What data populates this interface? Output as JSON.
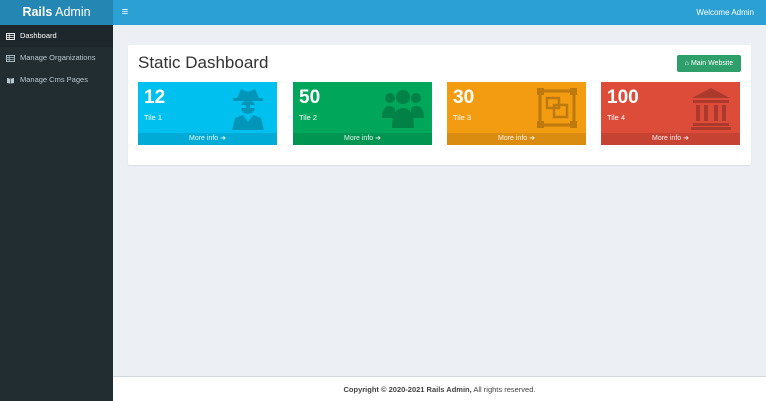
{
  "header": {
    "logo_bold": "Rails",
    "logo_light": "Admin",
    "menu_toggle": "≡",
    "welcome": "Welcome Admin"
  },
  "sidebar": {
    "items": [
      {
        "label": "Dashboard",
        "icon": "table-icon",
        "active": true
      },
      {
        "label": "Manage Organizations",
        "icon": "table-icon",
        "active": false
      },
      {
        "label": "Manage Cms Pages",
        "icon": "book-icon",
        "active": false
      }
    ]
  },
  "main": {
    "title": "Static Dashboard",
    "main_website_button": "Main Website",
    "tiles": [
      {
        "value": "12",
        "label": "Tile 1",
        "more": "More info",
        "icon": "user-secret-icon",
        "color": "#00c0ef"
      },
      {
        "value": "50",
        "label": "Tile 2",
        "more": "More info",
        "icon": "users-icon",
        "color": "#00a65a"
      },
      {
        "value": "30",
        "label": "Tile 3",
        "more": "More info",
        "icon": "object-group-icon",
        "color": "#f39c12"
      },
      {
        "value": "100",
        "label": "Tile 4",
        "more": "More info",
        "icon": "institution-icon",
        "color": "#dd4b39"
      }
    ]
  },
  "footer": {
    "copyright_bold": "Copyright © 2020-2021 Rails Admin,",
    "copyright_rest": " All rights reserved."
  },
  "colors": {
    "topbar": "#2aa0d4",
    "logo_bg": "#2486b3",
    "sidebar": "#222d32",
    "content_bg": "#ecf0f5",
    "button_green": "#2e9e6a"
  }
}
